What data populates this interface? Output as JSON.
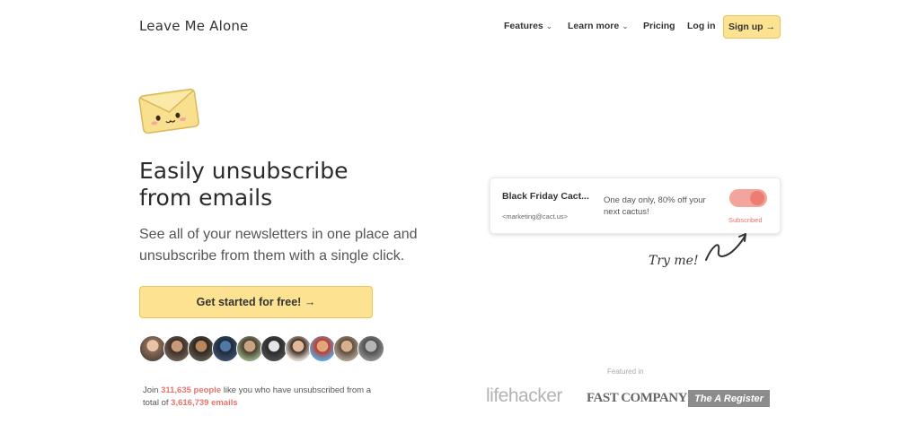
{
  "header": {
    "logo": "Leave Me Alone",
    "nav": [
      {
        "label": "Features",
        "icon": "chevron-down-icon"
      },
      {
        "label": "Learn more",
        "icon": "chevron-down-icon"
      },
      {
        "label": "Pricing"
      },
      {
        "label": "Log in"
      }
    ],
    "signup_label": "Sign up →"
  },
  "hero": {
    "icon": "envelope-mascot-icon",
    "headline_line1": "Easily unsubscribe",
    "headline_line2": "from emails",
    "subhead": "See all of your newsletters in one place and unsubscribe from them with a single click.",
    "cta_label": "Get started for free! →",
    "avatar_count": 10,
    "stats_prefix": "Join ",
    "stats_people": "311,635 people",
    "stats_mid": " like you who have unsubscribed from a total of ",
    "stats_emails": "3,616,739 emails"
  },
  "demo": {
    "sender_name": "Black Friday Cact...",
    "sender_email": "<marketing@cact.us>",
    "preview": "One day only, 80% off your next cactus!",
    "toggle_on": true,
    "status": "Subscribed",
    "try_me": "Try me!"
  },
  "featured": {
    "label": "Featured in",
    "logos": [
      "lifehacker",
      "FAST COMPANY",
      "The A Register"
    ]
  },
  "colors": {
    "accent_yellow": "#fde391",
    "accent_red": "#e8756d",
    "toggle_bg": "#f2a49d"
  }
}
